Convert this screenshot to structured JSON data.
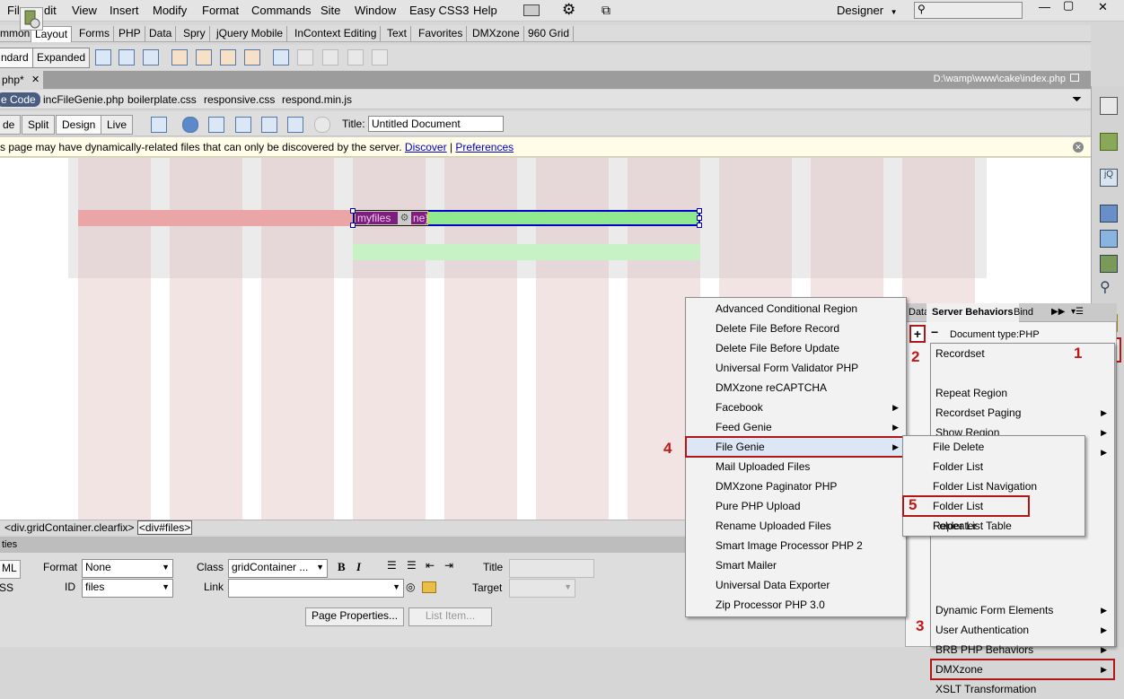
{
  "menubar": {
    "items": [
      "Fil",
      "dit",
      "View",
      "Insert",
      "Modify",
      "Format",
      "Commands",
      "Site",
      "Window",
      "Easy CSS3",
      "Help"
    ],
    "workspace": "Designer",
    "workspace_arrow": "▼"
  },
  "insert_tabs": [
    "mmon",
    "Layout",
    "Forms",
    "PHP",
    "Data",
    "Spry",
    "jQuery Mobile",
    "InContext Editing",
    "Text",
    "Favorites",
    "DMXzone",
    "960 Grid"
  ],
  "layout_modes": {
    "standard": "ndard",
    "expanded": "Expanded"
  },
  "document": {
    "tab_label": "php*",
    "close": "✕",
    "path": "D:\\wamp\\www\\cake\\index.php",
    "related_files": [
      "e Code",
      "incFileGenie.php",
      "boilerplate.css",
      "responsive.css",
      "respond.min.js"
    ],
    "views": [
      "de",
      "Split",
      "Design",
      "Live"
    ],
    "title_label": "Title:",
    "title_value": "Untitled Document",
    "info_text": "s page may have dynamically-related files that can only be discovered by the server.",
    "info_discover": "Discover",
    "info_sep": "|",
    "info_prefs": "Preferences",
    "element_label": "myfiles",
    "element_label2": "ne}"
  },
  "tag_selector": {
    "prefix": "<div.gridContainer.clearfix>",
    "current": "<div#files>"
  },
  "properties": {
    "header": "ties",
    "html_btn": "ML",
    "css_btn": "SS",
    "format_label": "Format",
    "format_value": "None",
    "class_label": "Class",
    "class_value": "gridContainer ...",
    "id_label": "ID",
    "id_value": "files",
    "link_label": "Link",
    "title_label": "Title",
    "target_label": "Target",
    "page_props": "Page Properties...",
    "list_item": "List Item...",
    "bold": "B",
    "italic": "I"
  },
  "server_behaviors": {
    "tabs": [
      "Data",
      "Server Behaviors",
      "Bind"
    ],
    "plus": "+",
    "minus": "−",
    "doc_type": "Document type:PHP"
  },
  "plus_menu": {
    "items": [
      {
        "label": "Recordset",
        "sub": false
      },
      {
        "label": "",
        "sub": false
      },
      {
        "label": "Repeat Region",
        "sub": false
      },
      {
        "label": "Recordset Paging",
        "sub": true
      },
      {
        "label": "Show Region",
        "sub": true
      },
      {
        "label": "",
        "sub": true
      },
      {
        "label": "",
        "sub": false
      },
      {
        "label": "",
        "sub": false
      },
      {
        "label": "",
        "sub": false
      },
      {
        "label": "",
        "sub": false
      },
      {
        "label": "",
        "sub": false
      },
      {
        "label": "",
        "sub": false
      },
      {
        "label": "",
        "sub": false
      },
      {
        "label": "Dynamic Form Elements",
        "sub": true
      },
      {
        "label": "User Authentication",
        "sub": true
      },
      {
        "label": "BRB PHP Behaviors",
        "sub": true
      },
      {
        "label": "DMXzone",
        "sub": true
      },
      {
        "label": "XSLT Transformation",
        "sub": false
      }
    ]
  },
  "dmxzone_menu": {
    "items": [
      {
        "label": "Advanced Conditional Region",
        "sub": false
      },
      {
        "label": "Delete File Before Record",
        "sub": false
      },
      {
        "label": "Delete File Before Update",
        "sub": false
      },
      {
        "label": "Universal Form Validator PHP",
        "sub": false
      },
      {
        "label": "DMXzone reCAPTCHA",
        "sub": false
      },
      {
        "label": "Facebook",
        "sub": true
      },
      {
        "label": "Feed Genie",
        "sub": true
      },
      {
        "label": "File Genie",
        "sub": true
      },
      {
        "label": "Mail Uploaded Files",
        "sub": false
      },
      {
        "label": "DMXzone Paginator PHP",
        "sub": false
      },
      {
        "label": "Pure PHP Upload",
        "sub": false
      },
      {
        "label": "Rename Uploaded Files",
        "sub": false
      },
      {
        "label": "Smart Image Processor PHP 2",
        "sub": false
      },
      {
        "label": "Smart Mailer",
        "sub": false
      },
      {
        "label": "Universal Data Exporter",
        "sub": false
      },
      {
        "label": "Zip Processor PHP 3.0",
        "sub": false
      }
    ]
  },
  "file_genie_menu": {
    "items": [
      "File Delete",
      "Folder List",
      "Folder List Navigation",
      "Folder List Repeater",
      "Folder List Table"
    ]
  },
  "steps": [
    "1",
    "2",
    "3",
    "4",
    "5"
  ],
  "colors": {
    "highlight": "#b01717",
    "step": "#c01818",
    "selection_blue": "#0000cc",
    "selection_green": "#90e890"
  }
}
